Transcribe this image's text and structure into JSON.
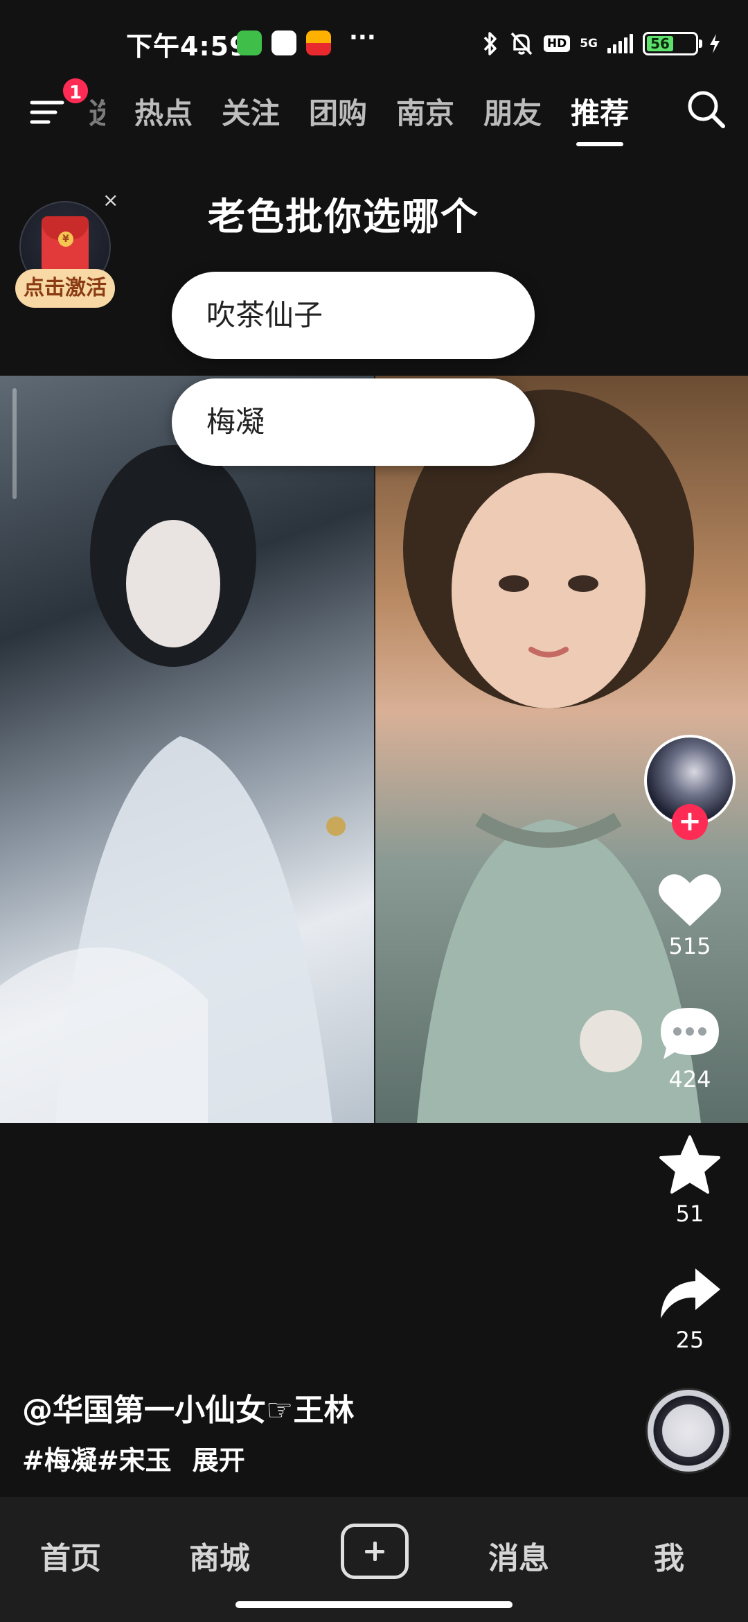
{
  "status_bar": {
    "time": "下午4:59",
    "more": "···",
    "network": "5G",
    "hd_label": "HD",
    "battery": "56",
    "battery_level": 56
  },
  "top_nav": {
    "badge_count": "1",
    "partial_tab": "选",
    "tabs": [
      "热点",
      "关注",
      "团购",
      "南京",
      "朋友",
      "推荐"
    ],
    "active_tab": "推荐"
  },
  "red_packet": {
    "label": "点击激活",
    "close": "×",
    "coin": "¥"
  },
  "poll": {
    "title": "老色批你选哪个",
    "options": [
      "吹茶仙子",
      "梅凝"
    ]
  },
  "actions": {
    "likes": "515",
    "comments": "424",
    "favorites": "51",
    "shares": "25"
  },
  "caption": {
    "author": "@华国第一小仙女☞王林",
    "hashtags": "#梅凝#宋玉",
    "expand": "展开"
  },
  "bottom_nav": {
    "items": [
      "首页",
      "商城",
      "消息",
      "我"
    ]
  },
  "colors": {
    "accent": "#fe2c55",
    "background": "#121212",
    "battery_green": "#5ee06c"
  }
}
